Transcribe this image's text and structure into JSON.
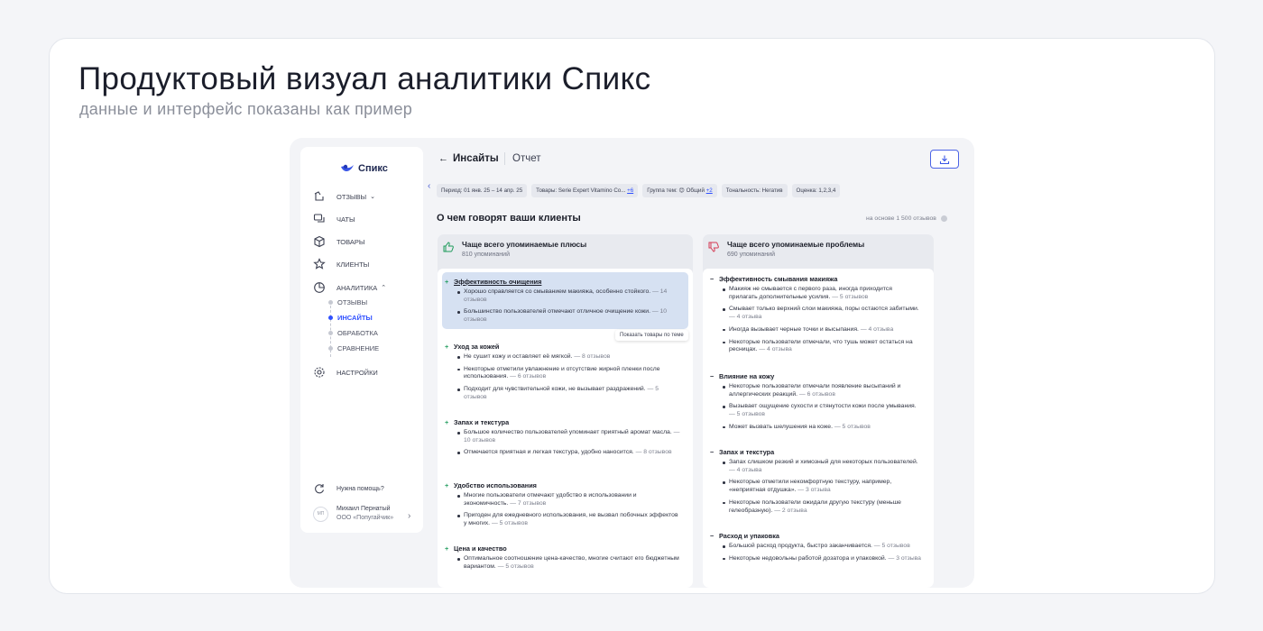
{
  "hero": {
    "title": "Продуктовый визуал аналитики Спикс",
    "subtitle": "данные и интерфейс показаны как пример"
  },
  "sidebar": {
    "brand": "Спикс",
    "items": [
      {
        "label": "ОТЗЫВЫ",
        "icon": "reviews-icon"
      },
      {
        "label": "ЧАТЫ",
        "icon": "chats-icon"
      },
      {
        "label": "ТОВАРЫ",
        "icon": "box-icon"
      },
      {
        "label": "КЛИЕНТЫ",
        "icon": "star-icon"
      },
      {
        "label": "АНАЛИТИКА",
        "icon": "pie-chart-icon"
      }
    ],
    "analytics_sub": [
      {
        "label": "ОТЗЫВЫ",
        "active": false
      },
      {
        "label": "ИНСАЙТЫ",
        "active": true
      },
      {
        "label": "ОБРАБОТКА",
        "active": false
      },
      {
        "label": "СРАВНЕНИЕ",
        "active": false
      }
    ],
    "settings": "НАСТРОЙКИ",
    "help": "Нужна помощь?",
    "user": {
      "initials": "МП",
      "name": "Михаил Пернатый",
      "org": "ООО «Попугайчик»"
    }
  },
  "header": {
    "title": "Инсайты",
    "report_tab": "Отчет"
  },
  "filters": {
    "period": "Период: 01 янв. 25 – 14 апр. 25",
    "products": "Товары: Serie Expert Vitamino Co...",
    "products_more": "+6",
    "group": "Группа тем: 😊 Общий",
    "group_more": "+2",
    "tonality": "Тональность: Негатив",
    "rating": "Оценка: 1,2,3,4"
  },
  "section": {
    "title": "О чем говорят ваши клиенты",
    "basis": "на основе 1 500 отзывов"
  },
  "pros": {
    "title": "Чаще всего упоминаемые плюсы",
    "count": "810 упоминаний",
    "tooltip": "Показать товары по теме",
    "groups": [
      {
        "title": "Эффективность очищения",
        "items": [
          {
            "text": "Хорошо справляется со смыванием макияжа, особенно стойкого.",
            "count": "— 14 отзывов"
          },
          {
            "text": "Большинство пользователей отмечают отличное очищение кожи.",
            "count": "— 10 отзывов"
          }
        ]
      },
      {
        "title": "Уход за кожей",
        "items": [
          {
            "text": "Не сушит кожу и оставляет её мягкой.",
            "count": "— 8 отзывов"
          },
          {
            "text": "Некоторые отметили увлажнение и отсутствие жирной пленки после использования.",
            "count": "— 6 отзывов"
          },
          {
            "text": "Подходит для чувствительной кожи, не вызывает раздражений.",
            "count": "— 5 отзывов"
          }
        ]
      },
      {
        "title": "Запах и текстура",
        "items": [
          {
            "text": "Большое количество пользователей упоминает приятный аромат масла.",
            "count": "— 10 отзывов"
          },
          {
            "text": "Отмечается приятная и легкая текстура, удобно наносится.",
            "count": "— 8 отзывов"
          }
        ]
      },
      {
        "title": "Удобство использования",
        "items": [
          {
            "text": "Многие пользователи отмечают удобство в использовании и экономичность.",
            "count": "— 7 отзывов"
          },
          {
            "text": "Пригоден для ежедневного использования, не вызвал побочных эффектов у многих.",
            "count": "— 5 отзывов"
          }
        ]
      },
      {
        "title": "Цена и качество",
        "items": [
          {
            "text": "Оптимальное соотношение цена-качество, многие считают его бюджетным вариантом.",
            "count": "— 5 отзывов"
          }
        ]
      }
    ]
  },
  "cons": {
    "title": "Чаще всего упоминаемые проблемы",
    "count": "690 упоминаний",
    "groups": [
      {
        "title": "Эффективность смывания макияжа",
        "items": [
          {
            "text": "Макияж не смывается с первого раза, иногда приходится прилагать дополнительные усилия.",
            "count": "— 5 отзывов"
          },
          {
            "text": "Смывает только верхний слои макияжа, поры остаются забитыми.",
            "count": "— 4 отзыва"
          },
          {
            "text": "Иногда вызывает черные точки и высыпания.",
            "count": "— 4 отзыва"
          },
          {
            "text": "Некоторые пользователи отмечали, что тушь может остаться на ресницах.",
            "count": "— 4 отзыва"
          }
        ]
      },
      {
        "title": "Влияние на кожу",
        "items": [
          {
            "text": "Некоторые пользователи отмечали появление высыпаний и аллергических реакций.",
            "count": "— 6 отзывов"
          },
          {
            "text": "Вызывает ощущение сухости и стянутости кожи после умывания.",
            "count": "— 5 отзывов"
          },
          {
            "text": "Может вызвать шелушения на коже.",
            "count": "— 5 отзывов"
          }
        ]
      },
      {
        "title": "Запах и текстура",
        "items": [
          {
            "text": "Запах слишком резкий и химозный для некоторых пользователей.",
            "count": "— 4 отзыва"
          },
          {
            "text": "Некоторые отметили некомфортную текстуру, например, «неприятная отдушка».",
            "count": "— 3 отзыва"
          },
          {
            "text": "Некоторые пользователи ожидали другую текстуру (меньше гелеобразную).",
            "count": "— 2 отзыва"
          }
        ]
      },
      {
        "title": "Расход и упаковка",
        "items": [
          {
            "text": "Большой расход продукта, быстро заканчивается.",
            "count": "— 5 отзывов"
          },
          {
            "text": "Некоторые недовольны работой дозатора и упаковкой.",
            "count": "— 3 отзыва"
          }
        ]
      }
    ]
  },
  "colors": {
    "accent": "#2f50ff",
    "plus": "#1c9a5a",
    "minus": "#d53b54",
    "highlight": "#d6e1f2"
  }
}
